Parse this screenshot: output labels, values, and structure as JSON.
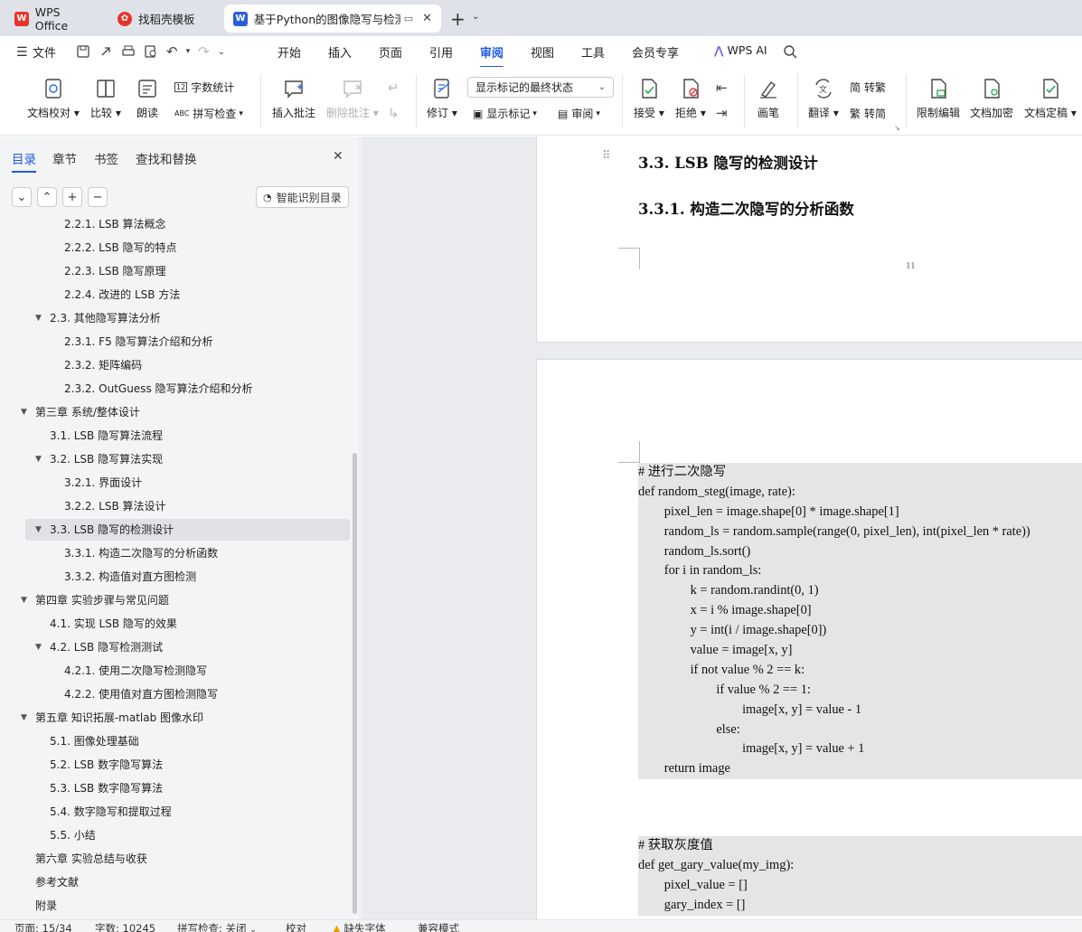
{
  "tabs": [
    {
      "label": "WPS Office"
    },
    {
      "label": "找稻壳模板"
    },
    {
      "label": "基于Python的图像隐写与检测"
    }
  ],
  "menu": {
    "file": "文件",
    "items": [
      "开始",
      "插入",
      "页面",
      "引用",
      "审阅",
      "视图",
      "工具",
      "会员专享"
    ],
    "active": "审阅",
    "ai": "WPS AI"
  },
  "ribbon": {
    "proofread": "文档校对",
    "compare": "比较",
    "read_aloud": "朗读",
    "word_count": "字数统计",
    "spell_check": "拼写检查",
    "insert_comment": "插入批注",
    "delete_comment": "删除批注",
    "track": "修订",
    "markup_state": "显示标记的最终状态",
    "show_markup": "显示标记",
    "review": "审阅",
    "accept": "接受",
    "reject": "拒绝",
    "pen": "画笔",
    "translate": "翻译",
    "to_traditional": "转繁",
    "to_simplified": "转简",
    "restrict": "限制编辑",
    "encrypt": "文档加密",
    "finalize": "文档定稿"
  },
  "sidebar": {
    "tabs": [
      "目录",
      "章节",
      "书签",
      "查找和替换"
    ],
    "smart_toc": "智能识别目录",
    "toc": [
      {
        "label": "2.2.1. LSB 算法概念",
        "level": 3
      },
      {
        "label": "2.2.2. LSB 隐写的特点",
        "level": 3
      },
      {
        "label": "2.2.3. LSB 隐写原理",
        "level": 3
      },
      {
        "label": "2.2.4. 改进的 LSB 方法",
        "level": 3
      },
      {
        "label": "2.3. 其他隐写算法分析",
        "level": 2,
        "expanded": true
      },
      {
        "label": "2.3.1. F5 隐写算法介绍和分析",
        "level": 3
      },
      {
        "label": "2.3.2. 矩阵编码",
        "level": 3
      },
      {
        "label": "2.3.2. OutGuess 隐写算法介绍和分析",
        "level": 3
      },
      {
        "label": "第三章 系统/整体设计",
        "level": 1,
        "expanded": true
      },
      {
        "label": "3.1. LSB 隐写算法流程",
        "level": 2
      },
      {
        "label": "3.2. LSB 隐写算法实现",
        "level": 2,
        "expanded": true
      },
      {
        "label": "3.2.1. 界面设计",
        "level": 3
      },
      {
        "label": "3.2.2. LSB 算法设计",
        "level": 3
      },
      {
        "label": "3.3. LSB 隐写的检测设计",
        "level": 2,
        "expanded": true,
        "selected": true
      },
      {
        "label": "3.3.1. 构造二次隐写的分析函数",
        "level": 3
      },
      {
        "label": "3.3.2. 构造值对直方图检测",
        "level": 3
      },
      {
        "label": "第四章 实验步骤与常见问题",
        "level": 1,
        "expanded": true
      },
      {
        "label": "4.1. 实现 LSB 隐写的效果",
        "level": 2
      },
      {
        "label": "4.2. LSB 隐写检测测试",
        "level": 2,
        "expanded": true
      },
      {
        "label": "4.2.1. 使用二次隐写检测隐写",
        "level": 3
      },
      {
        "label": "4.2.2. 使用值对直方图检测隐写",
        "level": 3
      },
      {
        "label": "第五章 知识拓展-matlab 图像水印",
        "level": 1,
        "expanded": true
      },
      {
        "label": "5.1. 图像处理基础",
        "level": 2
      },
      {
        "label": "5.2. LSB 数字隐写算法",
        "level": 2
      },
      {
        "label": "5.3. LSB 数字隐写算法",
        "level": 2
      },
      {
        "label": "5.4. 数字隐写和提取过程",
        "level": 2
      },
      {
        "label": "5.5. 小结",
        "level": 2
      },
      {
        "label": "第六章 实验总结与收获",
        "level": 1
      },
      {
        "label": "参考文献",
        "level": 1
      },
      {
        "label": "附录",
        "level": 1
      }
    ]
  },
  "document": {
    "heading_33": "3.3. LSB 隐写的检测设计",
    "heading_331": "3.3.1.  构造二次隐写的分析函数",
    "page_number": "11",
    "code1": [
      "# 进行二次隐写",
      "def random_steg(image, rate):",
      "        pixel_len = image.shape[0] * image.shape[1]",
      "        random_ls = random.sample(range(0, pixel_len), int(pixel_len * rate))",
      "        random_ls.sort()",
      "        for i in random_ls:",
      "                k = random.randint(0, 1)",
      "                x = i % image.shape[0]",
      "                y = int(i / image.shape[0])",
      "                value = image[x, y]",
      "                if not value % 2 == k:",
      "                        if value % 2 == 1:",
      "                                image[x, y] = value - 1",
      "                        else:",
      "                                image[x, y] = value + 1",
      "        return image"
    ],
    "code2": [
      "# 获取灰度值",
      "def get_gary_value(my_img):",
      "        pixel_value = []",
      "        gary_index = []"
    ]
  },
  "status": {
    "page": "页面: 15/34",
    "words": "字数: 10245",
    "spell": "拼写检查: 关闭",
    "proof": "校对",
    "missing_font": "缺失字体",
    "compat": "兼容模式"
  },
  "colors": {
    "accent": "#1f5be3",
    "sidebar_bg": "#f3f4f6",
    "doc_bg": "#e9ebee",
    "code_bg": "#e5e5e5"
  }
}
